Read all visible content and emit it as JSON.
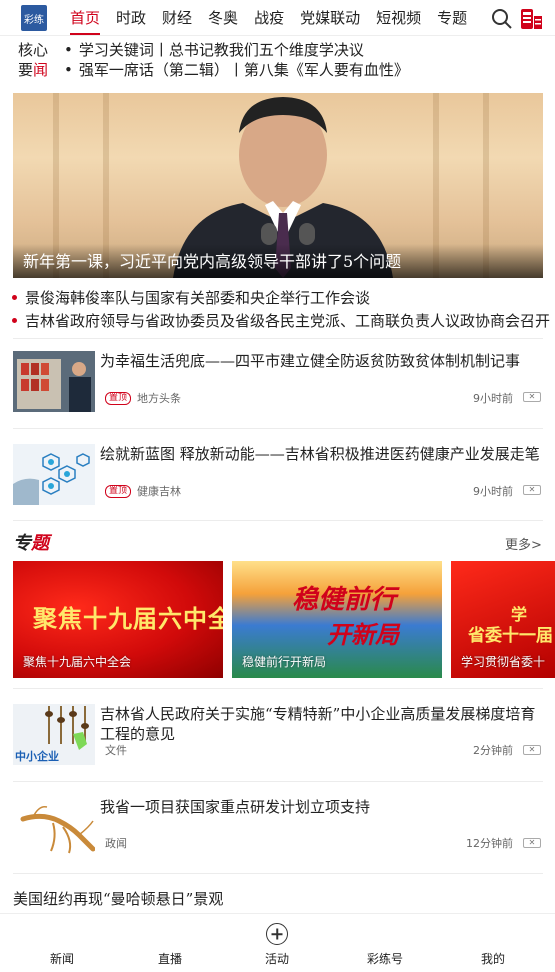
{
  "nav": {
    "logo_text": "彩练",
    "tabs": [
      "首页",
      "时政",
      "财经",
      "冬奥",
      "战疫",
      "党媒联动",
      "短视频",
      "专题"
    ],
    "active_tab": 0
  },
  "core_news": {
    "label_line1": "核心",
    "label_line2_a": "要",
    "label_line2_b": "闻",
    "items": [
      "学习关键词丨总书记教我们五个维度学决议",
      "强军一席话（第二辑）丨第八集《军人要有血性》"
    ]
  },
  "hero": {
    "caption": "新年第一课，习近平向党内高级领导干部讲了5个问题"
  },
  "headlines": [
    "景俊海韩俊率队与国家有关部委和央企举行工作会谈",
    "吉林省政府领导与省政协委员及省级各民主党派、工商联负责人议政协商会召开"
  ],
  "news": [
    {
      "title": "为幸福生活兜底——四平市建立健全防返贫防致贫体制机制记事",
      "tag": "置顶",
      "source": "地方头条",
      "time": "9小时前"
    },
    {
      "title": "绘就新蓝图 释放新动能——吉林省积极推进医药健康产业发展走笔",
      "tag": "置顶",
      "source": "健康吉林",
      "time": "9小时前"
    }
  ],
  "special": {
    "title_a": "专",
    "title_b": "题",
    "more": "更多>",
    "topics": [
      {
        "art": "聚焦十九届六中全会",
        "caption": "聚焦十九届六中全会"
      },
      {
        "art1": "稳健前行",
        "art2": "开新局",
        "caption": "稳健前行开新局"
      },
      {
        "art1": "学",
        "art2": "省委十一届",
        "caption": "学习贯彻省委十"
      }
    ]
  },
  "news2": [
    {
      "title": "吉林省人民政府关于实施“专精特新”中小企业高质量发展梯度培育工程的意见",
      "source": "文件",
      "time": "2分钟前",
      "thumb_text": "中小企业"
    },
    {
      "title": "我省一项目获国家重点研发计划立项支持",
      "source": "政闻",
      "time": "12分钟前"
    }
  ],
  "last_title": "美国纽约再现“曼哈顿悬日”景观",
  "tabbar": [
    "新闻",
    "直播",
    "活动",
    "彩练号",
    "我的"
  ],
  "colors": {
    "accent": "#d0021b"
  }
}
